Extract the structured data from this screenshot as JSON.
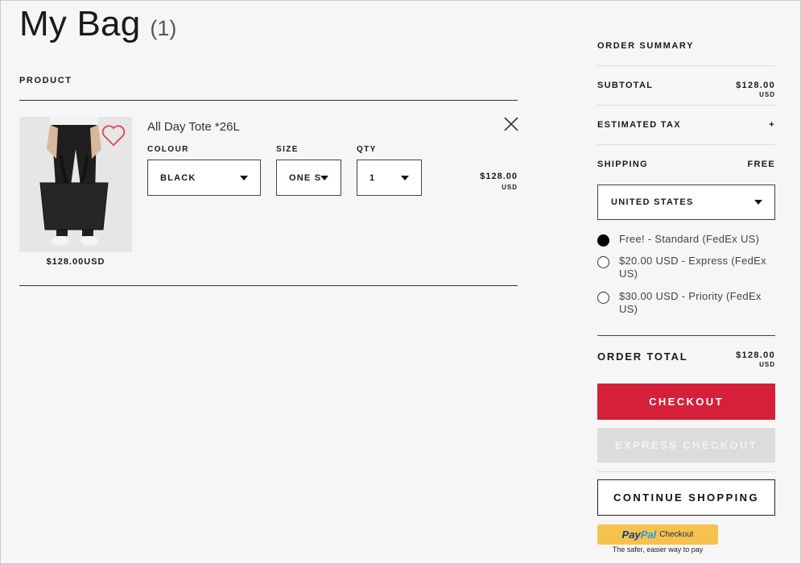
{
  "page": {
    "title": "My Bag",
    "count": "(1)"
  },
  "cart": {
    "column_header": "PRODUCT",
    "item": {
      "name": "All Day Tote *26L",
      "thumb_price": "$128.00USD",
      "price": "$128.00",
      "currency": "USD",
      "colour_label": "COLOUR",
      "colour_value": "BLACK",
      "size_label": "SIZE",
      "size_value": "ONE SIZE",
      "qty_label": "QTY",
      "qty_value": "1",
      "image_icon": "tote-bag-photo",
      "wishlist_icon": "heart-icon",
      "remove_icon": "close-icon"
    }
  },
  "summary": {
    "title": "ORDER SUMMARY",
    "subtotal_label": "SUBTOTAL",
    "subtotal_value": "$128.00",
    "subtotal_currency": "USD",
    "tax_label": "ESTIMATED TAX",
    "tax_value": "+",
    "shipping_label": "SHIPPING",
    "shipping_value": "FREE",
    "country": "UNITED STATES",
    "shipping_options": [
      {
        "label": "Free! - Standard (FedEx US)",
        "selected": true
      },
      {
        "label": "$20.00 USD - Express (FedEx US)",
        "selected": false
      },
      {
        "label": "$30.00 USD - Priority (FedEx US)",
        "selected": false
      }
    ],
    "total_label": "ORDER TOTAL",
    "total_value": "$128.00",
    "total_currency": "USD",
    "checkout_label": "CHECKOUT",
    "express_label": "EXPRESS CHECKOUT",
    "continue_label": "CONTINUE SHOPPING",
    "paypal": {
      "pay": "Pay",
      "pal": "Pal",
      "checkout": "Checkout",
      "tagline": "The safer, easier way to pay"
    }
  },
  "colors": {
    "checkout": "#d6203a",
    "express": "#dcdcdc",
    "paypal": "#f7c14d",
    "heart": "#e0475d"
  }
}
